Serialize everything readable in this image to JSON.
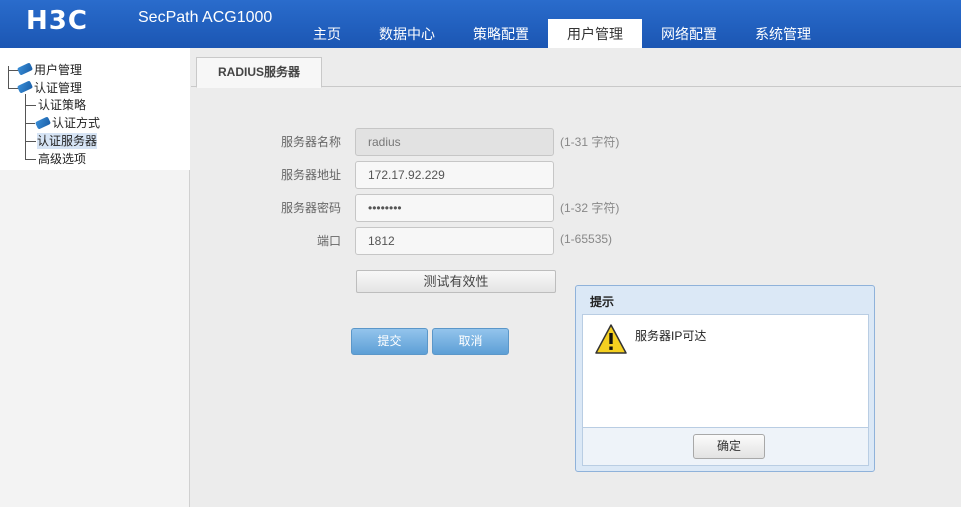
{
  "header": {
    "logo": "H3C",
    "product": "SecPath ACG1000",
    "nav": [
      "主页",
      "数据中心",
      "策略配置",
      "用户管理",
      "网络配置",
      "系统管理"
    ],
    "active_nav": "用户管理",
    "color": "#1f5fbf"
  },
  "sidebar": {
    "tree": {
      "user_mgmt": "用户管理",
      "auth_mgmt": "认证管理",
      "auth_policy": "认证策略",
      "auth_method": "认证方式",
      "auth_server": "认证服务器",
      "advanced": "高级选项"
    },
    "selected": "认证服务器"
  },
  "tab": {
    "label": "RADIUS服务器"
  },
  "form": {
    "server_name": {
      "label": "服务器名称",
      "value": "radius",
      "hint": "(1-31 字符)",
      "disabled": true
    },
    "server_addr": {
      "label": "服务器地址",
      "value": "172.17.92.229"
    },
    "server_pwd": {
      "label": "服务器密码",
      "value": "••••••••",
      "hint": "(1-32 字符)"
    },
    "port": {
      "label": "端口",
      "value": "1812",
      "hint": "(1-65535)"
    },
    "test_button": "测试有效性",
    "submit_button": "提交",
    "cancel_button": "取消"
  },
  "dialog": {
    "title": "提示",
    "message": "服务器IP可达",
    "ok_button": "确定",
    "icon": "warning-icon"
  }
}
